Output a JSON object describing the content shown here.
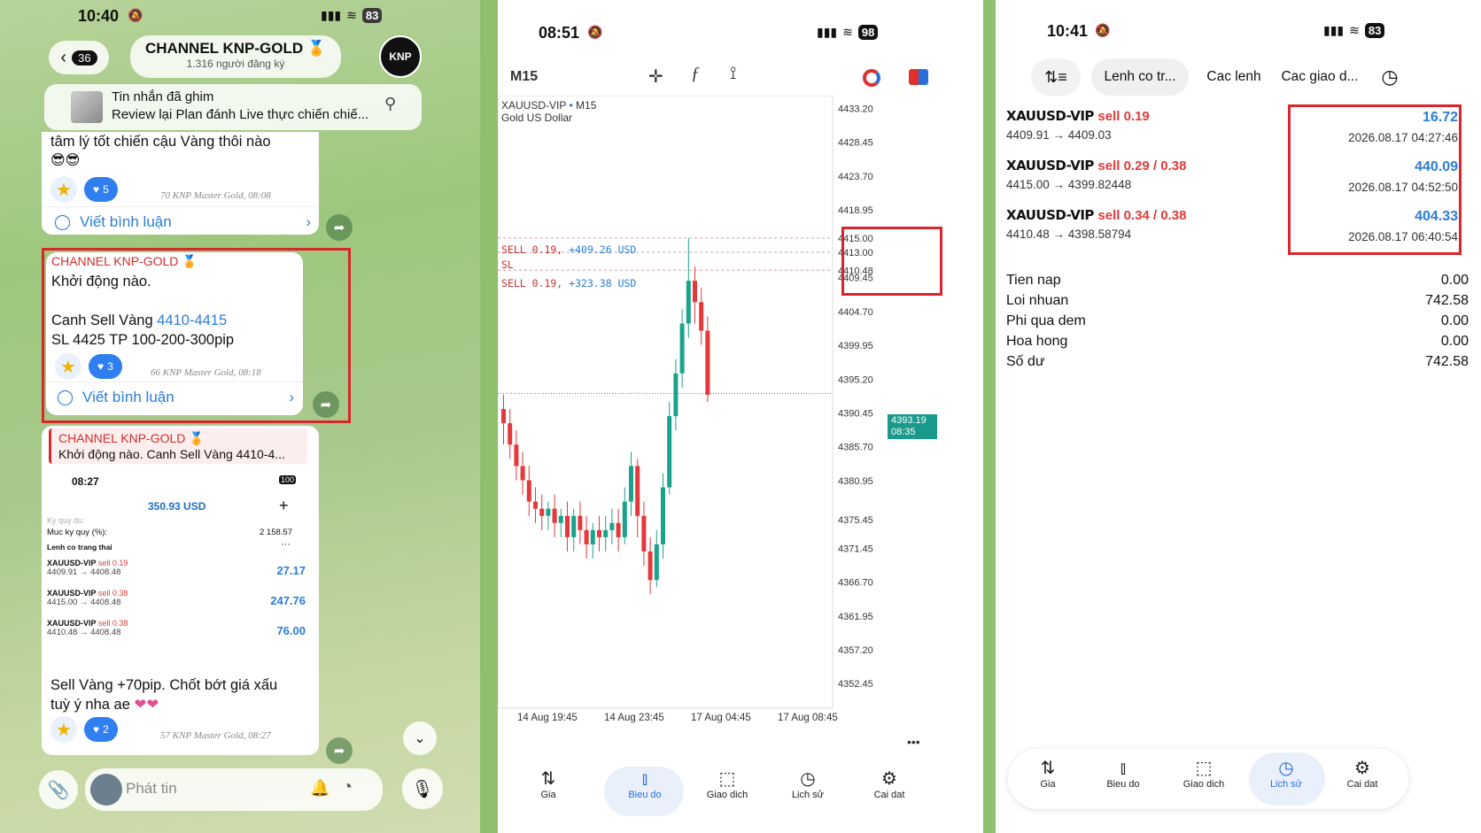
{
  "telegram": {
    "status_time": "10:40",
    "battery": "83",
    "back_count": "36",
    "channel_title": "CHANNEL KNP-GOLD",
    "subscribers": "1.316 người đăng ký",
    "avatar_text": "KNP",
    "pinned_title": "Tin nhắn đã ghim",
    "pinned_text": "Review lại Plan đánh Live thực chiến chiế...",
    "msg0_text": "tâm lý tốt chiến cậu Vàng thôi nào",
    "msg0_heart": "5",
    "msg0_meta": "70 KNP Master Gold, 08:08",
    "comment_label": "Viết bình luận",
    "msg1_channel": "CHANNEL KNP-GOLD",
    "msg1_line1": "Khởi động nào.",
    "msg1_line2_prefix": "Canh Sell Vàng ",
    "msg1_line2_link": "4410-4415",
    "msg1_line3": "SL 4425 TP 100-200-300pip",
    "msg1_heart": "3",
    "msg1_meta": "66 KNP Master Gold, 08:18",
    "reply_channel": "CHANNEL KNP-GOLD",
    "reply_text": "Khởi động nào. Canh Sell Vàng 4410-4...",
    "inner": {
      "time": "08:27",
      "battery": "100",
      "balance": "350.93 USD",
      "margin_label": "Muc ky quy (%):",
      "margin_value": "2 158.57",
      "ky_quy_label": "Ky quy du:",
      "open_label": "Lenh co trang thai",
      "rows": [
        {
          "sym": "XAUUSD-VIP",
          "side": "sell 0.19",
          "prices": "4409.91 → 4408.48",
          "profit": "27.17"
        },
        {
          "sym": "XAUUSD-VIP",
          "side": "sell 0.38",
          "prices": "4415.00 → 4408.48",
          "profit": "247.76"
        },
        {
          "sym": "XAUUSD-VIP",
          "side": "sell 0.38",
          "prices": "4410.48 → 4408.48",
          "profit": "76.00"
        }
      ]
    },
    "msg2_line1": "Sell Vàng +70pip. Chốt bớt giá xấu",
    "msg2_line2": "tuỳ ý nha ae",
    "msg2_heart": "2",
    "msg2_meta": "57 KNP Master Gold, 08:27",
    "input_placeholder": "Phát tin"
  },
  "chart_screen": {
    "status_time": "08:51",
    "battery": "98",
    "timeframe": "M15",
    "symbol": "XAUUSD-VIP",
    "symbol_tf": "M15",
    "symbol_desc": "Gold US Dollar",
    "pos1_label": "SELL 0.19,",
    "pos1_profit": "+409.26 USD",
    "sl_label": "SL",
    "pos2_label": "SELL 0.19,",
    "pos2_profit": "+323.38 USD",
    "price_tag": "4393.19",
    "price_tag_time": "08:35",
    "more": "•••",
    "nav": [
      {
        "label": "Gia",
        "icon": "updown-arrows-icon"
      },
      {
        "label": "Bieu do",
        "icon": "candles-icon"
      },
      {
        "label": "Giao dich",
        "icon": "trend-icon"
      },
      {
        "label": "Lịch sử",
        "icon": "history-icon"
      },
      {
        "label": "Cai dat",
        "icon": "gear-icon"
      }
    ]
  },
  "chart_data": {
    "type": "candlestick",
    "y_ticks": [
      "4433.20",
      "4428.45",
      "4423.70",
      "4418.95",
      "4415.00",
      "4413.00",
      "4410.48",
      "4409.45",
      "4404.70",
      "4399.95",
      "4395.20",
      "4390.45",
      "4385.70",
      "4380.95",
      "4375.45",
      "4371.45",
      "4366.70",
      "4361.95",
      "4357.20",
      "4352.45"
    ],
    "x_ticks": [
      "14 Aug 19:45",
      "14 Aug 23:45",
      "17 Aug 04:45",
      "17 Aug 08:45"
    ],
    "ylim": [
      4349,
      4435
    ],
    "current_price": 4393.19,
    "levels": [
      4415.0,
      4413.0,
      4410.48
    ],
    "candles": [
      [
        4391,
        4389,
        4393,
        4386
      ],
      [
        4389,
        4386,
        4391,
        4384
      ],
      [
        4386,
        4383,
        4388,
        4381
      ],
      [
        4383,
        4381,
        4385,
        4379
      ],
      [
        4381,
        4378,
        4383,
        4376
      ],
      [
        4378,
        4377,
        4380,
        4375
      ],
      [
        4377,
        4376,
        4379,
        4374
      ],
      [
        4376,
        4377,
        4378,
        4374
      ],
      [
        4377,
        4375,
        4379,
        4373
      ],
      [
        4375,
        4376,
        4377,
        4373
      ],
      [
        4376,
        4373,
        4378,
        4371
      ],
      [
        4373,
        4376,
        4377,
        4371
      ],
      [
        4376,
        4374,
        4378,
        4372
      ],
      [
        4374,
        4372,
        4376,
        4370
      ],
      [
        4372,
        4374,
        4375,
        4370
      ],
      [
        4374,
        4373,
        4376,
        4371
      ],
      [
        4373,
        4374,
        4376,
        4371
      ],
      [
        4374,
        4375,
        4377,
        4372
      ],
      [
        4375,
        4373,
        4377,
        4371
      ],
      [
        4373,
        4378,
        4380,
        4372
      ],
      [
        4378,
        4383,
        4385,
        4376
      ],
      [
        4383,
        4376,
        4384,
        4373
      ],
      [
        4376,
        4371,
        4378,
        4369
      ],
      [
        4371,
        4367,
        4373,
        4365
      ],
      [
        4367,
        4372,
        4374,
        4366
      ],
      [
        4372,
        4380,
        4382,
        4370
      ],
      [
        4380,
        4390,
        4392,
        4379
      ],
      [
        4390,
        4396,
        4398,
        4388
      ],
      [
        4396,
        4403,
        4405,
        4394
      ],
      [
        4403,
        4409,
        4415,
        4401
      ],
      [
        4409,
        4406,
        4411,
        4403
      ],
      [
        4406,
        4402,
        4408,
        4400
      ],
      [
        4402,
        4393,
        4404,
        4392
      ]
    ]
  },
  "history": {
    "status_time": "10:41",
    "battery": "83",
    "tabs": [
      "Lenh co tr...",
      "Cac lenh",
      "Cac giao d..."
    ],
    "rows": [
      {
        "sym": "XAUUSD-VIP",
        "side": "sell 0.19",
        "prices": "4409.91 → 4409.03",
        "profit": "16.72",
        "time": "2026.08.17 04:27:46"
      },
      {
        "sym": "XAUUSD-VIP",
        "side": "sell 0.29 / 0.38",
        "prices": "4415.00 → 4399.82448",
        "profit": "440.09",
        "time": "2026.08.17 04:52:50"
      },
      {
        "sym": "XAUUSD-VIP",
        "side": "sell 0.34 / 0.38",
        "prices": "4410.48 → 4398.58794",
        "profit": "404.33",
        "time": "2026.08.17 06:40:54"
      }
    ],
    "summary": [
      {
        "label": "Tien nap",
        "value": "0.00"
      },
      {
        "label": "Loi nhuan",
        "value": "742.58"
      },
      {
        "label": "Phi qua dem",
        "value": "0.00"
      },
      {
        "label": "Hoa hong",
        "value": "0.00"
      },
      {
        "label": "Số dư",
        "value": "742.58"
      }
    ],
    "nav": [
      {
        "label": "Gia",
        "icon": "updown-arrows-icon"
      },
      {
        "label": "Bieu do",
        "icon": "candles-icon"
      },
      {
        "label": "Giao dich",
        "icon": "trend-icon"
      },
      {
        "label": "Lich sử",
        "icon": "history-icon"
      },
      {
        "label": "Cai dat",
        "icon": "gear-icon"
      }
    ]
  }
}
